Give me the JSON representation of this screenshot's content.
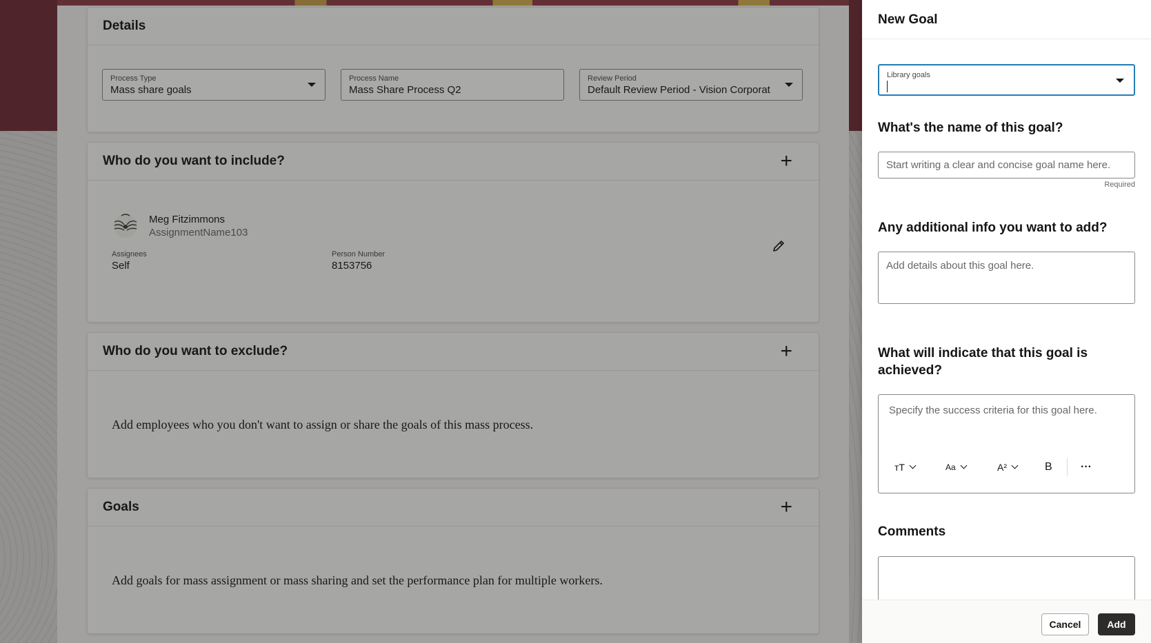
{
  "details": {
    "title": "Details",
    "process_type": {
      "label": "Process Type",
      "value": "Mass share goals"
    },
    "process_name": {
      "label": "Process Name",
      "value": "Mass Share Process Q2"
    },
    "review_period": {
      "label": "Review Period",
      "value": "Default Review Period - Vision Corporat"
    }
  },
  "include": {
    "title": "Who do you want to include?",
    "person": {
      "name": "Meg Fitzimmons",
      "assignment": "AssignmentName103",
      "assignees_label": "Assignees",
      "assignees_value": "Self",
      "person_number_label": "Person Number",
      "person_number_value": "8153756"
    }
  },
  "exclude": {
    "title": "Who do you want to exclude?",
    "description": "Add employees who you don't want to assign or share the goals of this mass process."
  },
  "goals": {
    "title": "Goals",
    "description": "Add goals for mass assignment or mass sharing and set the performance plan for multiple workers."
  },
  "drawer": {
    "title": "New Goal",
    "library_goals_label": "Library goals",
    "name_question": "What's the name of this goal?",
    "name_placeholder": "Start writing a clear and concise goal name here.",
    "required": "Required",
    "info_question": "Any additional info you want to add?",
    "info_placeholder": "Add details about this goal here.",
    "achieved_question_1": "What will indicate that this goal is",
    "achieved_question_2": "achieved?",
    "achieved_placeholder": "Specify the success criteria for this goal here.",
    "toolbar": {
      "text_size": "тT",
      "font": "Aa",
      "superscript": "A²",
      "bold": "B",
      "more": "···"
    },
    "comments_label": "Comments",
    "cancel": "Cancel",
    "add": "Add"
  },
  "colors": {
    "brand_band": "#6e2a36",
    "focus_border": "#227cb5",
    "primary_button": "#2e2c2a"
  }
}
